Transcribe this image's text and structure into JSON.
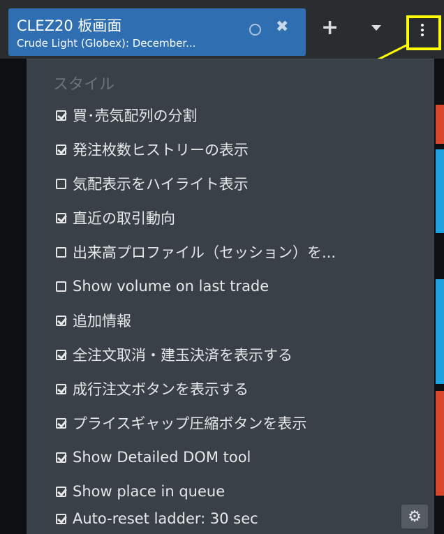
{
  "tab": {
    "title": "CLEZ20 板画面",
    "subtitle": "Crude Light (Globex): December..."
  },
  "colors": {
    "tab_bg": "#2f6fb1",
    "menu_bg": "#3a4047",
    "highlight": "#ffff00",
    "accent_red": "#d9472b",
    "accent_blue": "#1fa3e0"
  },
  "menu": {
    "header": "スタイル",
    "items": [
      {
        "label": "買･売気配列の分割",
        "checked": true
      },
      {
        "label": "発注枚数ヒストリーの表示",
        "checked": true
      },
      {
        "label": "気配表示をハイライト表示",
        "checked": false
      },
      {
        "label": "直近の取引動向",
        "checked": true
      },
      {
        "label": "出来高プロファイル（セッション）を...",
        "checked": false
      },
      {
        "label": "Show volume on last trade",
        "checked": false
      },
      {
        "label": "追加情報",
        "checked": true
      },
      {
        "label": "全注文取消・建玉決済を表示する",
        "checked": true
      },
      {
        "label": "成行注文ボタンを表示する",
        "checked": true
      },
      {
        "label": "プライスギャップ圧縮ボタンを表示",
        "checked": true
      },
      {
        "label": "Show Detailed DOM tool",
        "checked": true
      },
      {
        "label": "Show place in queue",
        "checked": true
      },
      {
        "label": "Auto-reset ladder: 30 sec",
        "checked": true
      }
    ]
  },
  "icons": {
    "close": "close-icon",
    "plus": "plus-icon",
    "caret": "chevron-down-icon",
    "kebab": "kebab-menu-icon",
    "gear": "gear-icon"
  }
}
